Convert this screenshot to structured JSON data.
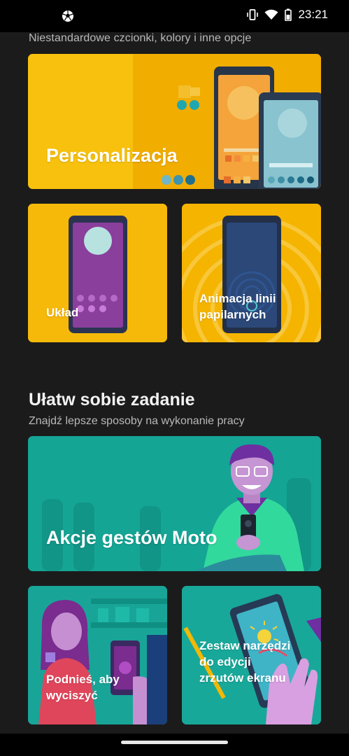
{
  "status_bar": {
    "time": "23:21",
    "icons": [
      "soccer-ball-icon",
      "vibrate-icon",
      "wifi-icon",
      "battery-icon"
    ]
  },
  "section_personalize": {
    "subtitle": "Niestandardowe czcionki, kolory i inne opcje",
    "cards": {
      "personalization": "Personalizacja",
      "layout": "Układ",
      "fingerprint": "Animacja linii papilarnych"
    }
  },
  "section_easier": {
    "title": "Ułatw sobie zadanie",
    "subtitle": "Znajdź lepsze sposoby na wykonanie pracy",
    "cards": {
      "gestures": "Akcje gestów Moto",
      "lift_to_silence": "Podnieś, aby wyciszyć",
      "screenshot_tools": "Zestaw narzędzi do edycji zrzutów ekranu"
    }
  },
  "colors": {
    "background": "#1b1b1b",
    "yellow_card": "#f5b800",
    "teal_card": "#13a596"
  }
}
